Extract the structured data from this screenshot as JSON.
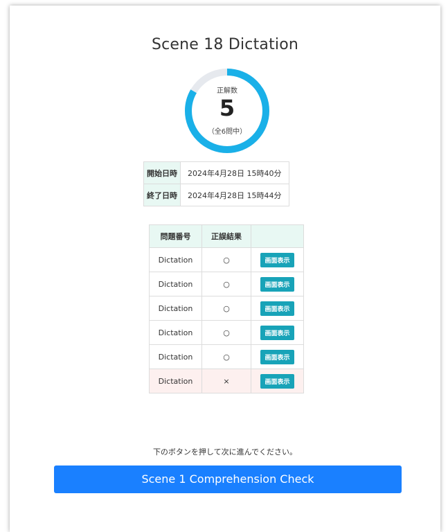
{
  "page": {
    "title": "Scene 18 Dictation"
  },
  "score": {
    "label": "正解数",
    "value": "5",
    "total_text": "（全6問中）",
    "correct": 5,
    "total": 6,
    "ring_color": "#1ab0e8",
    "track_color": "#e6e9ee"
  },
  "times": {
    "start_label": "開始日時",
    "start_value": "2024年4月28日 15時40分",
    "end_label": "終了日時",
    "end_value": "2024年4月28日 15時44分"
  },
  "results": {
    "headers": [
      "問題番号",
      "正誤結果",
      ""
    ],
    "button_label": "画面表示",
    "rows": [
      {
        "name": "Dictation",
        "result": "○"
      },
      {
        "name": "Dictation",
        "result": "○"
      },
      {
        "name": "Dictation",
        "result": "○"
      },
      {
        "name": "Dictation",
        "result": "○"
      },
      {
        "name": "Dictation",
        "result": "○"
      },
      {
        "name": "Dictation",
        "result": "×"
      }
    ]
  },
  "footer": {
    "note": "下のボタンを押して次に進んでください。",
    "next_button": "Scene 1 Comprehension Check",
    "accent_color": "#1a80ff"
  }
}
